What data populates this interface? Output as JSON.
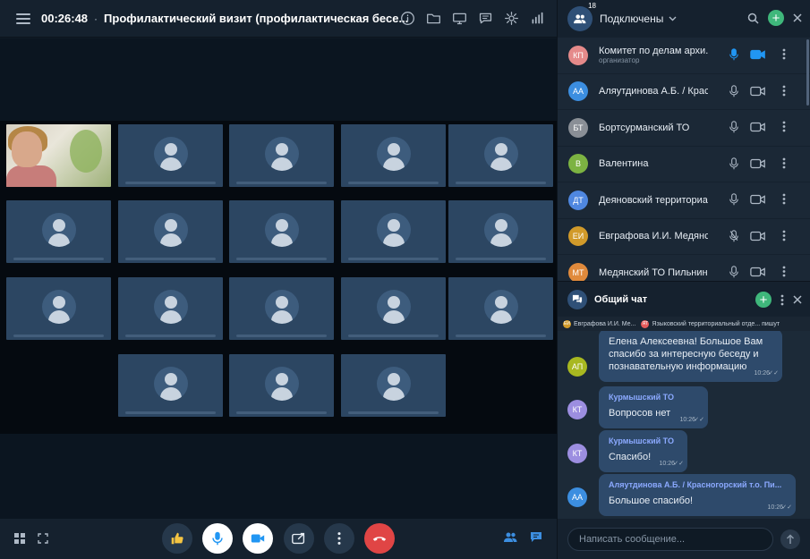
{
  "header": {
    "timer": "00:26:48",
    "separator": "·",
    "title": "Профилактический визит (профилактическая бесе..."
  },
  "top_icons": [
    "info-icon",
    "folder-icon",
    "screen-share-icon",
    "chat-bubble-icon",
    "gear-icon",
    "signal-icon"
  ],
  "grid": {
    "rows": [
      [
        {
          "type": "photo"
        },
        {
          "type": "avatar"
        },
        {
          "type": "avatar"
        },
        {
          "type": "avatar"
        },
        {
          "type": "avatar"
        }
      ],
      [
        {
          "type": "avatar"
        },
        {
          "type": "avatar"
        },
        {
          "type": "avatar"
        },
        {
          "type": "avatar"
        },
        {
          "type": "avatar"
        }
      ],
      [
        {
          "type": "avatar"
        },
        {
          "type": "avatar"
        },
        {
          "type": "avatar"
        },
        {
          "type": "avatar"
        },
        {
          "type": "avatar"
        }
      ],
      [
        {
          "type": "avatar"
        },
        {
          "type": "avatar"
        },
        {
          "type": "avatar"
        }
      ]
    ]
  },
  "bottom": {
    "left_icons": [
      "grid-view-icon",
      "fullscreen-icon"
    ],
    "controls": [
      "thumbs-up-icon",
      "microphone-icon",
      "camera-icon",
      "share-screen-icon",
      "more-icon",
      "hang-up-icon"
    ],
    "right_icons": [
      "participants-icon",
      "chat-icon"
    ]
  },
  "participants": {
    "count": "18",
    "title": "Подключены",
    "list": [
      {
        "initials": "КП",
        "name": "Комитет по делам архи...",
        "role": "организатор",
        "color": "#e58a8a",
        "mic": "active",
        "cam": "active"
      },
      {
        "initials": "АА",
        "name": "Аляутдинова А.Б. / Крас...",
        "role": "",
        "color": "#3c8ee0",
        "mic": "on",
        "cam": "off"
      },
      {
        "initials": "БТ",
        "name": "Бортсурманский ТО",
        "role": "",
        "color": "#8a8f96",
        "mic": "on",
        "cam": "off"
      },
      {
        "initials": "В",
        "name": "Валентина",
        "role": "",
        "color": "#7cb342",
        "mic": "on",
        "cam": "off"
      },
      {
        "initials": "ДТ",
        "name": "Деяновский территориа...",
        "role": "",
        "color": "#4f87e0",
        "mic": "on",
        "cam": "off"
      },
      {
        "initials": "ЕИ",
        "name": "Евграфова И.И. Медянс...",
        "role": "",
        "color": "#d19a2a",
        "mic": "muted",
        "cam": "off"
      },
      {
        "initials": "МТ",
        "name": "Медянский ТО Пильнин...",
        "role": "",
        "color": "#e08a3c",
        "mic": "on",
        "cam": "off"
      }
    ]
  },
  "chat": {
    "title": "Общий чат",
    "typing": [
      {
        "initials": "ЕИ",
        "color": "#d19a2a",
        "text": "Евграфова И.И. Ме..."
      },
      {
        "initials": "ЯТ",
        "color": "#e55a5a",
        "text": "Языковский территориальный отде... пишут"
      }
    ],
    "messages": [
      {
        "initials": "АП",
        "color": "#a8b820",
        "author": "",
        "text": "Елена Алексеевна! Большое Вам спасибо за  интересную беседу и познавательную информацию",
        "time": "10:26"
      },
      {
        "initials": "КТ",
        "color": "#9c8ee0",
        "author": "Курмышский ТО",
        "text": "Вопросов нет",
        "time": "10:26"
      },
      {
        "initials": "КТ",
        "color": "#9c8ee0",
        "author": "Курмышский ТО",
        "text": "Спасибо!",
        "time": "10:26"
      },
      {
        "initials": "АА",
        "color": "#3c8ee0",
        "author": "Аляутдинова А.Б. / Красногорский т.о. Пи...",
        "text": "Большое спасибо!",
        "time": "10:26"
      }
    ],
    "input_placeholder": "Написать сообщение..."
  }
}
